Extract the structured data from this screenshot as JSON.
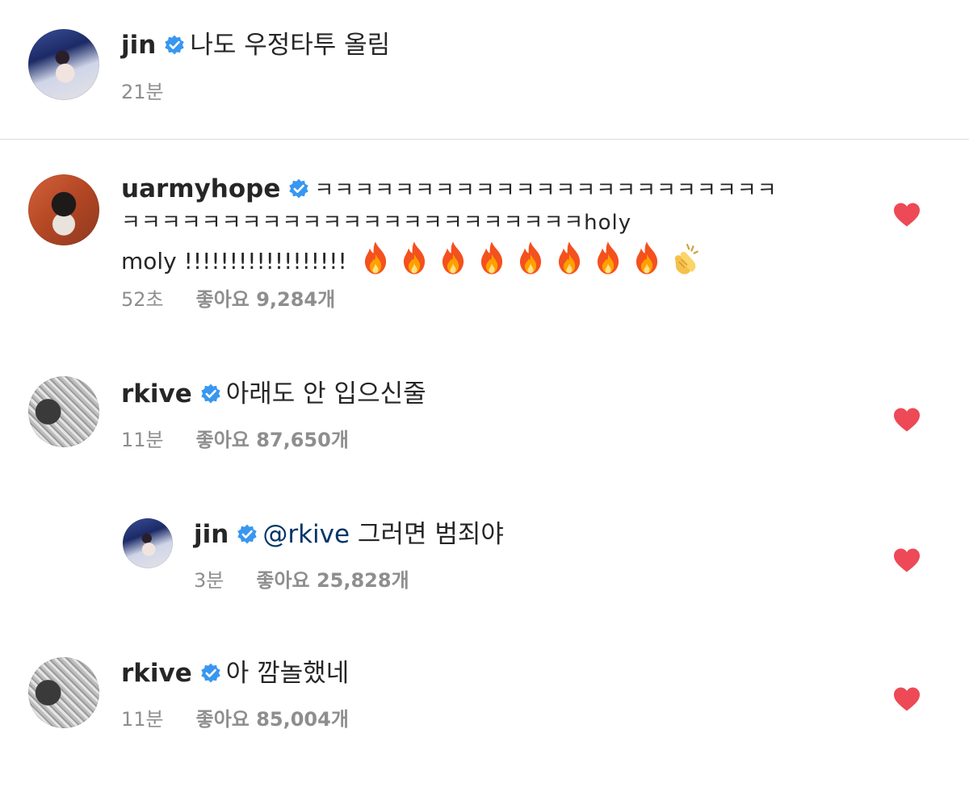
{
  "caption": {
    "username": "jin",
    "text": "나도 우정타투 올림",
    "time": "21분"
  },
  "comments": [
    {
      "username": "uarmyhope",
      "text_line1": "ㅋㅋㅋㅋㅋㅋㅋㅋㅋㅋㅋㅋㅋㅋㅋㅋㅋㅋㅋㅋㅋㅋㅋ",
      "text_line2": "ㅋㅋㅋㅋㅋㅋㅋㅋㅋㅋㅋㅋㅋㅋㅋㅋㅋㅋㅋㅋㅋㅋㅋholy",
      "text_line3": "moly !!!!!!!!!!!!!!!!!!",
      "emojis": [
        "fire",
        "fire",
        "fire",
        "fire",
        "fire",
        "fire",
        "fire",
        "fire",
        "clapping-hands"
      ],
      "time": "52초",
      "likes": "좋아요 9,284개",
      "liked": true
    },
    {
      "username": "rkive",
      "text": "아래도 안 입으신줄",
      "time": "11분",
      "likes": "좋아요 87,650개",
      "liked": true
    },
    {
      "username": "jin",
      "mention": "@rkive",
      "text": "그러면 범죄야",
      "time": "3분",
      "likes": "좋아요 25,828개",
      "liked": true,
      "is_reply": true
    },
    {
      "username": "rkive",
      "text": "아 깜놀했네",
      "time": "11분",
      "likes": "좋아요 85,004개",
      "liked": true
    }
  ],
  "colors": {
    "verified_badge": "#3897f0",
    "heart": "#ed4956",
    "secondary_text": "#8e8e8e",
    "mention": "#003569"
  }
}
